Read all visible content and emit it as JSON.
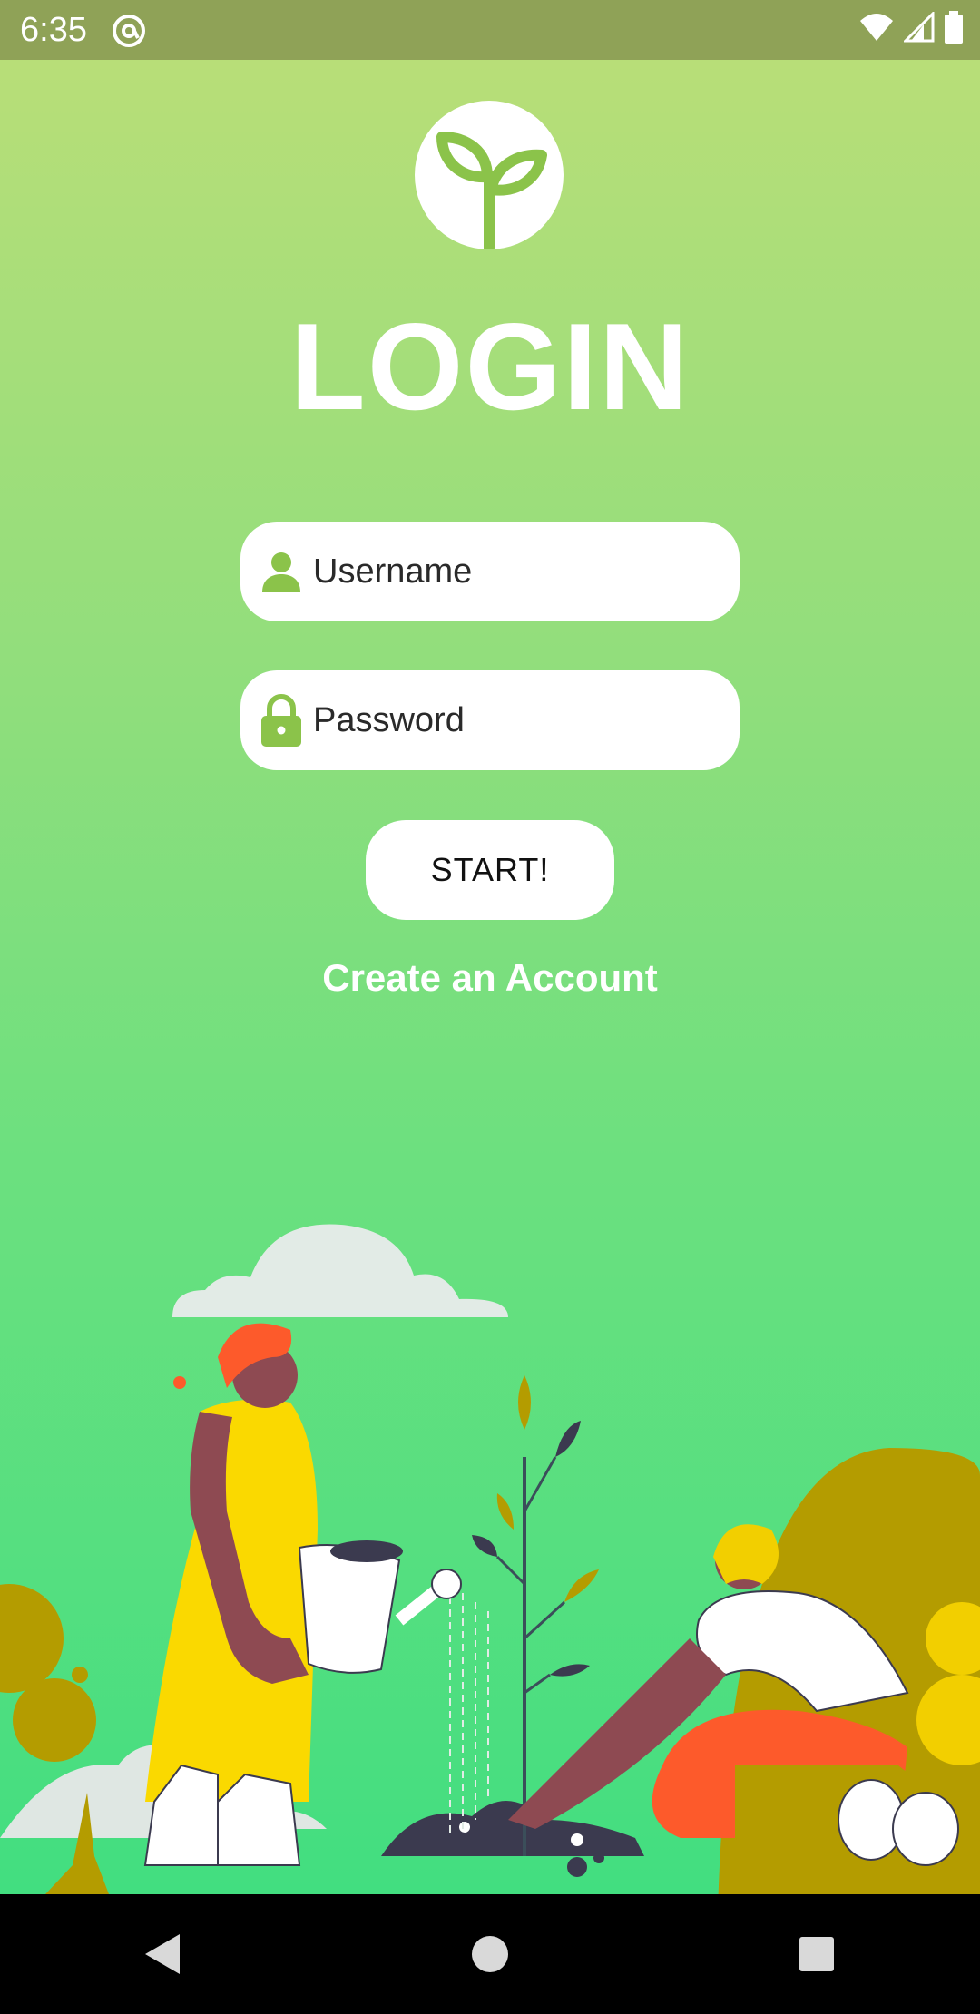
{
  "status_bar": {
    "time": "6:35",
    "icons": [
      "at-sign-icon",
      "wifi-icon",
      "signal-icon",
      "battery-icon"
    ]
  },
  "app": {
    "title": "LOGIN",
    "logo_icon": "sprout-icon"
  },
  "form": {
    "username": {
      "placeholder": "Username",
      "value": "",
      "icon": "person-icon"
    },
    "password": {
      "placeholder": "Password",
      "value": "",
      "icon": "lock-icon"
    },
    "start_label": "START!",
    "create_account_label": "Create an Account"
  },
  "nav": {
    "icons": [
      "back-icon",
      "home-icon",
      "recents-icon"
    ]
  },
  "colors": {
    "accent_green": "#8bc34a",
    "status_bar": "#8fa257",
    "gradient_top": "#b8de78",
    "gradient_bottom": "#42de80"
  }
}
